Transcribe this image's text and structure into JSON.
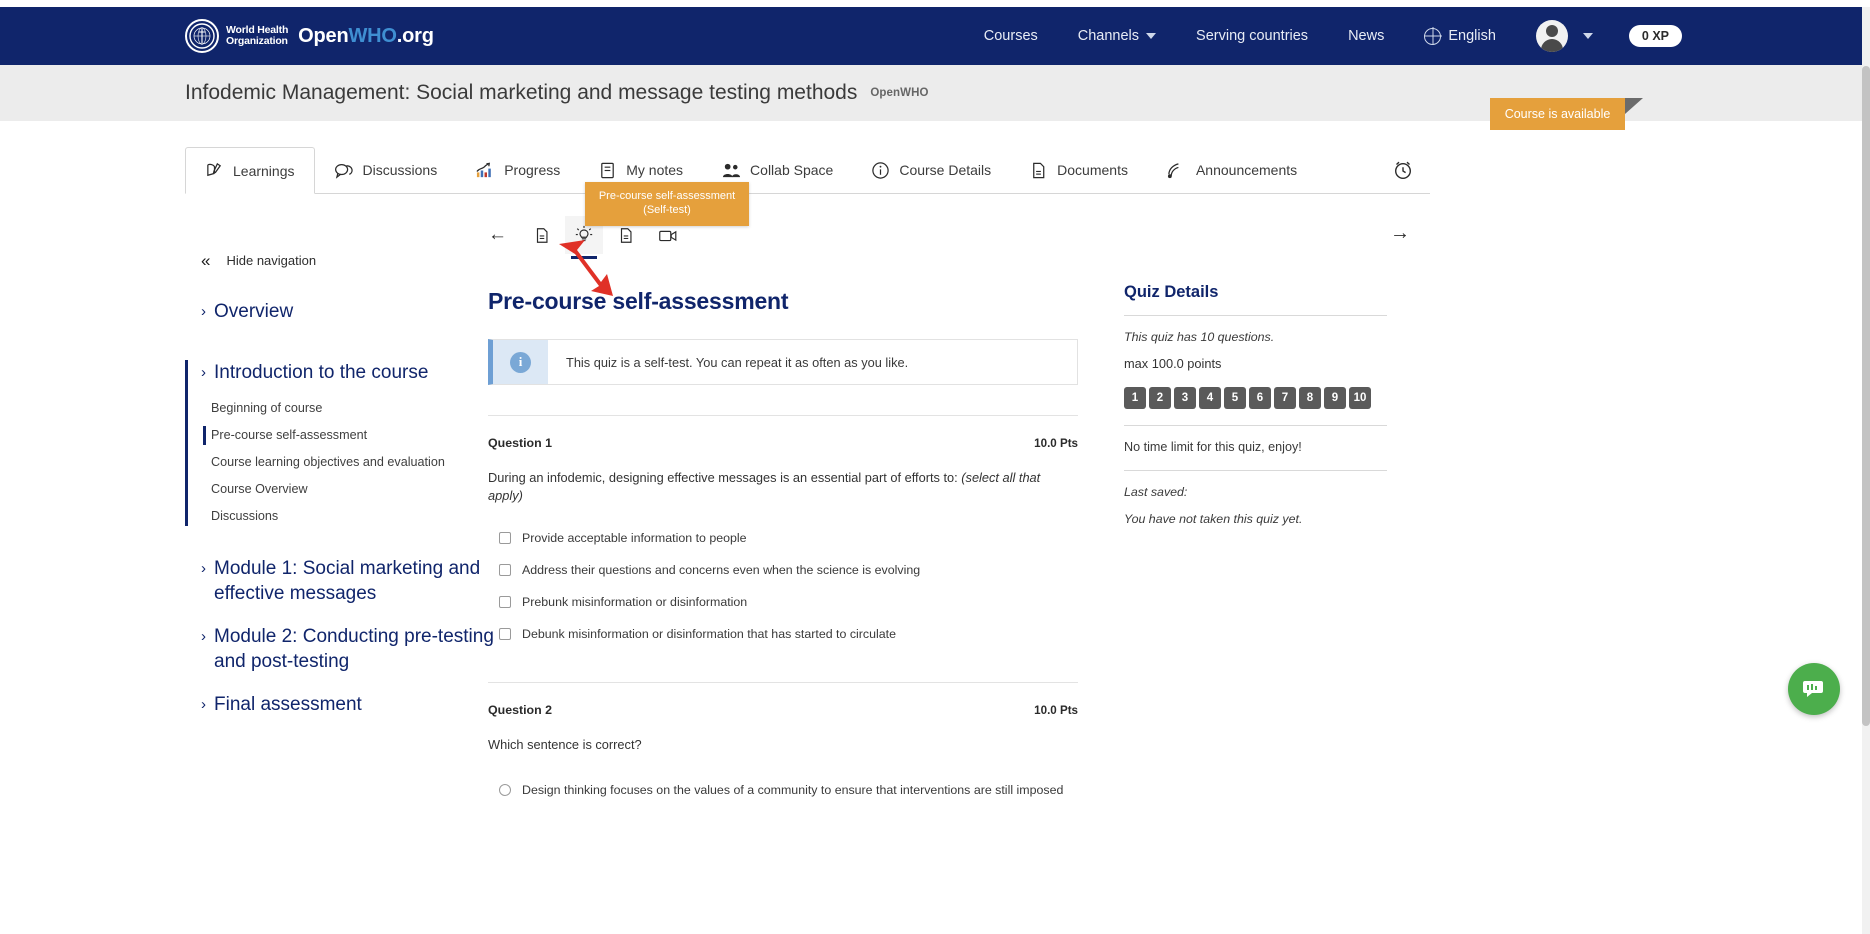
{
  "topbar": {
    "org_line1": "World Health",
    "org_line2": "Organization",
    "site_name_prefix": "Open",
    "site_name_highlight": "WHO",
    "site_name_suffix": ".org",
    "nav": [
      {
        "label": "Courses",
        "icon": "none"
      },
      {
        "label": "Channels",
        "icon": "chevron-down-icon"
      },
      {
        "label": "Serving countries",
        "icon": "none"
      },
      {
        "label": "News",
        "icon": "none"
      }
    ],
    "language": "English",
    "language_icon": "globe-icon",
    "avatar_icon": "user-avatar-icon",
    "avatar_caret": "chevron-down-icon",
    "xp_badge": "0 XP"
  },
  "course_header": {
    "title": "Infodemic Management: Social marketing and message testing methods",
    "org": "OpenWHO",
    "availability_badge": "Course is available",
    "badge_color": "#e5a03c"
  },
  "tabs": [
    {
      "label": "Learnings",
      "icon": "learnings-icon",
      "active": true
    },
    {
      "label": "Discussions",
      "icon": "discussions-icon",
      "active": false
    },
    {
      "label": "Progress",
      "icon": "progress-icon",
      "active": false
    },
    {
      "label": "My notes",
      "icon": "notes-icon",
      "active": false
    },
    {
      "label": "Collab Space",
      "icon": "collab-space-icon",
      "active": false
    },
    {
      "label": "Course Details",
      "icon": "info-icon",
      "active": false
    },
    {
      "label": "Documents",
      "icon": "documents-icon",
      "active": false
    },
    {
      "label": "Announcements",
      "icon": "announcements-icon",
      "active": false
    }
  ],
  "tab_right_icon": "reminder-clock-icon",
  "tooltip": {
    "line1": "Pre-course self-assessment",
    "line2": "(Self-test)"
  },
  "sidebar": {
    "hide_navigation": "Hide navigation",
    "hide_icon": "chevron-double-left-icon",
    "groups": [
      {
        "title": "Overview",
        "open": false,
        "items": []
      },
      {
        "title": "Introduction to the course",
        "open": true,
        "items": [
          {
            "label": "Beginning of course",
            "current": false
          },
          {
            "label": "Pre-course self-assessment",
            "current": true
          },
          {
            "label": "Course learning objectives and evaluation",
            "current": false
          },
          {
            "label": "Course Overview",
            "current": false
          },
          {
            "label": "Discussions",
            "current": false
          }
        ]
      },
      {
        "title": "Module 1: Social marketing and effective messages",
        "open": false,
        "items": []
      },
      {
        "title": "Module 2: Conducting pre-testing and post-testing",
        "open": false,
        "items": []
      },
      {
        "title": "Final assessment",
        "open": false,
        "items": []
      }
    ]
  },
  "content_pager": {
    "back_icon": "arrow-left-icon",
    "next_icon": "arrow-right-icon",
    "items": [
      {
        "icon": "document-icon",
        "active": false
      },
      {
        "icon": "self-test-bulb-icon",
        "active": true
      },
      {
        "icon": "document-icon",
        "active": false
      },
      {
        "icon": "video-icon",
        "active": false
      }
    ]
  },
  "quiz": {
    "title": "Pre-course self-assessment",
    "alert_icon": "info-icon",
    "alert_text": "This quiz is a self-test. You can repeat it as often as you like.",
    "questions": [
      {
        "label": "Question 1",
        "points": "10.0 Pts",
        "text": "During an infodemic, designing effective messages is an essential part of efforts to: ",
        "text_italic": "(select all that apply)",
        "input_type": "checkbox",
        "options": [
          "Provide acceptable information to people",
          "Address their questions and concerns even when the science is evolving",
          "Prebunk misinformation or disinformation",
          "Debunk misinformation or disinformation that has started to circulate"
        ]
      },
      {
        "label": "Question 2",
        "points": "10.0 Pts",
        "text": "Which sentence is correct?",
        "text_italic": "",
        "input_type": "radio",
        "options": [
          "Design thinking focuses on the values of a community to ensure that interventions are still imposed"
        ]
      }
    ]
  },
  "quiz_details": {
    "heading": "Quiz Details",
    "questions_count_text": "This quiz has 10 questions.",
    "max_points_text": "max 100.0 points",
    "question_numbers": [
      "1",
      "2",
      "3",
      "4",
      "5",
      "6",
      "7",
      "8",
      "9",
      "10"
    ],
    "time_limit_text": "No time limit for this quiz, enjoy!",
    "last_saved_label": "Last saved:",
    "last_saved_value": "You have not taken this quiz yet."
  },
  "chat_fab": {
    "icon": "chat-bubble-icon",
    "color": "#4cae4c"
  }
}
